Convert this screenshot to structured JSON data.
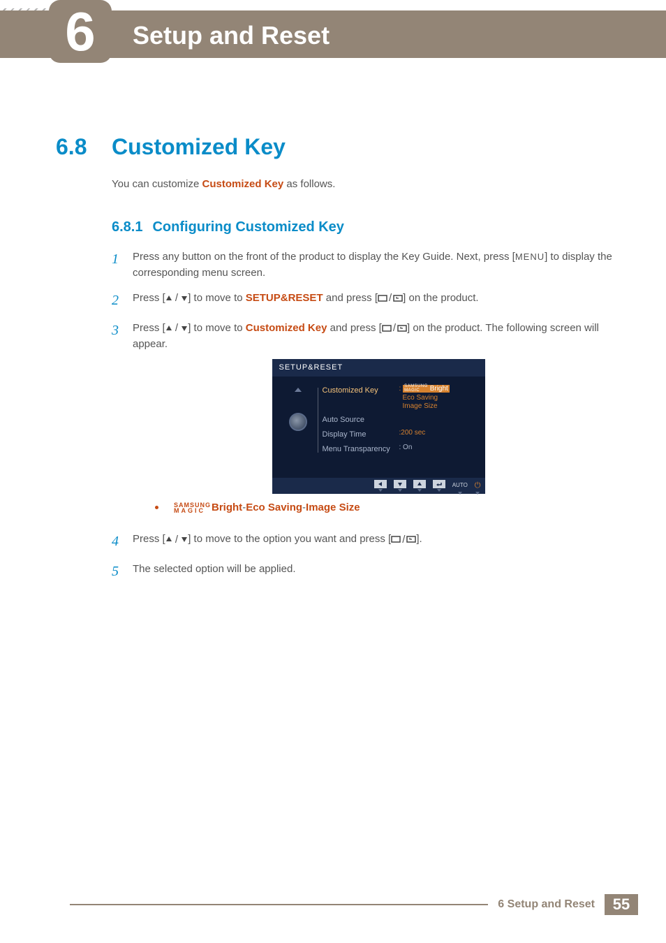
{
  "chapter": {
    "number": "6",
    "title": "Setup and Reset"
  },
  "section": {
    "number": "6.8",
    "title": "Customized Key"
  },
  "intro": {
    "pre": "You can customize ",
    "hl": "Customized Key",
    "post": " as follows."
  },
  "subsection": {
    "number": "6.8.1",
    "title": "Configuring Customized Key"
  },
  "steps": {
    "s1": {
      "n": "1",
      "a": "Press any button on the front of the product to display the Key Guide. Next, press [",
      "menu": "MENU",
      "b": "] to display the corresponding menu screen."
    },
    "s2": {
      "n": "2",
      "a": "Press [",
      "b": "] to move to ",
      "hl": "SETUP&RESET",
      "c": " and press [",
      "d": "] on the product."
    },
    "s3": {
      "n": "3",
      "a": "Press [",
      "b": "] to move to ",
      "hl": "Customized Key",
      "c": " and press [",
      "d": "] on the product. The following screen will appear."
    },
    "s4": {
      "n": "4",
      "a": "Press [",
      "b": "] to move to the option you want and press [",
      "c": "]."
    },
    "s5": {
      "n": "5",
      "a": "The selected option will be applied."
    }
  },
  "osd": {
    "title": "SETUP&RESET",
    "rows": {
      "r1": {
        "label": "Customized Key",
        "val_magic_top": "SAMSUNG",
        "val_magic_bot": "MAGIC",
        "val_bright": "Bright",
        "val2": "Eco Saving",
        "val3": "Image Size"
      },
      "r2": {
        "label": "Auto Source"
      },
      "r3": {
        "label": "Display Time",
        "val": ":200 sec"
      },
      "r4": {
        "label": "Menu Transparency",
        "val": ": On"
      }
    },
    "auto": "AUTO"
  },
  "bullet": {
    "magic_top": "SAMSUNG",
    "magic_bot": "MAGIC",
    "bright": "Bright",
    "sep": " - ",
    "eco": "Eco Saving",
    "img": "Image Size"
  },
  "footer": {
    "text": "6 Setup and Reset",
    "page": "55"
  }
}
